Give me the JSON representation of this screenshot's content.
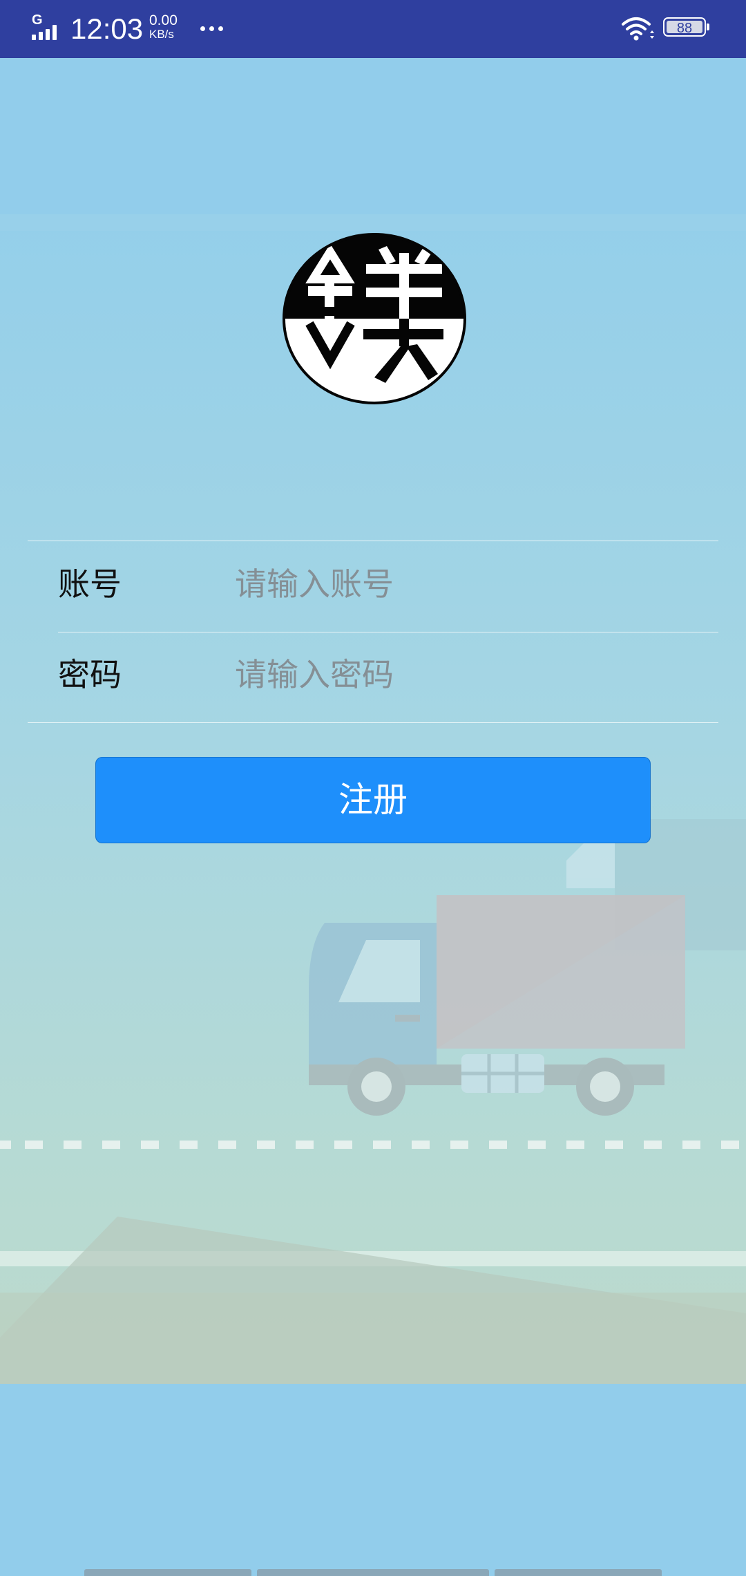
{
  "status_bar": {
    "network_type": "G",
    "time": "12:03",
    "net_speed_value": "0.00",
    "net_speed_unit": "KB/s",
    "battery_level": "88",
    "icons": [
      "signal-icon",
      "more-icon",
      "wifi-icon",
      "battery-icon"
    ]
  },
  "logo": {
    "icon": "company-logo"
  },
  "form": {
    "account_label": "账号",
    "account_placeholder": "请输入账号",
    "account_value": "",
    "password_label": "密码",
    "password_placeholder": "请输入密码",
    "password_value": "",
    "register_label": "注册"
  },
  "colors": {
    "status_bar": "#2f3f9f",
    "background": "#92cdeb",
    "button": "#1e8ffb"
  }
}
